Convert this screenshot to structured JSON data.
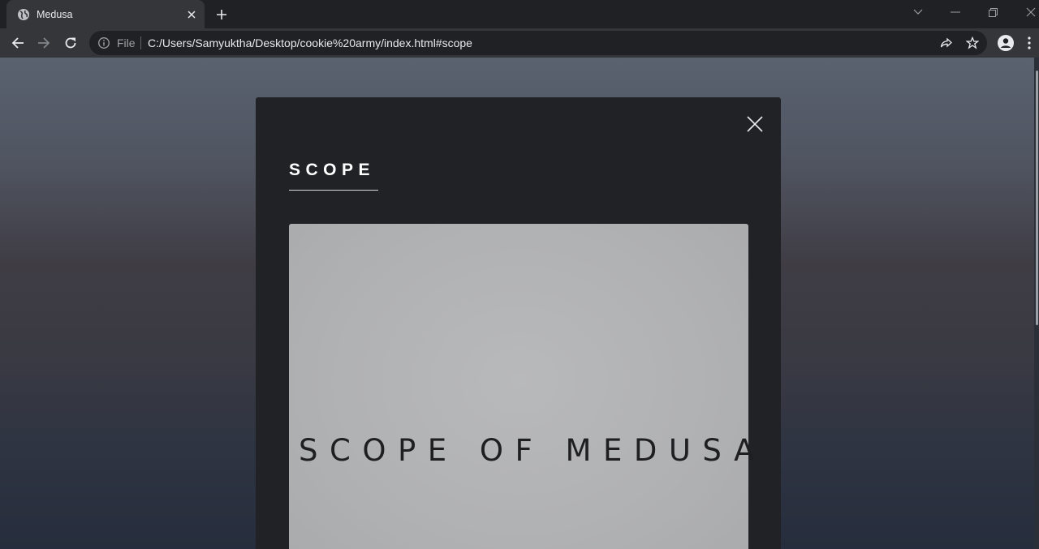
{
  "browser": {
    "tab": {
      "title": "Medusa",
      "favicon": "globe-icon"
    },
    "new_tab_icon": "plus-icon",
    "window_controls": [
      "tab-search-icon",
      "minimize-icon",
      "restore-icon",
      "close-icon"
    ],
    "nav": [
      "back-arrow-icon",
      "forward-arrow-icon",
      "reload-icon"
    ],
    "omnibox": {
      "security_label": "File",
      "url": "C:/Users/Samyuktha/Desktop/cookie%20army/index.html#scope"
    },
    "toolbar_right": [
      "share-icon",
      "star-icon",
      "profile-icon",
      "kebab-menu-icon"
    ]
  },
  "modal": {
    "title": "SCOPE",
    "image_text": "SCOPE OF MEDUSA"
  },
  "colors": {
    "chrome_dark": "#202124",
    "chrome_toolbar": "#35363a",
    "modal_bg": "#202226",
    "image_bg": "#b0b1b3"
  }
}
